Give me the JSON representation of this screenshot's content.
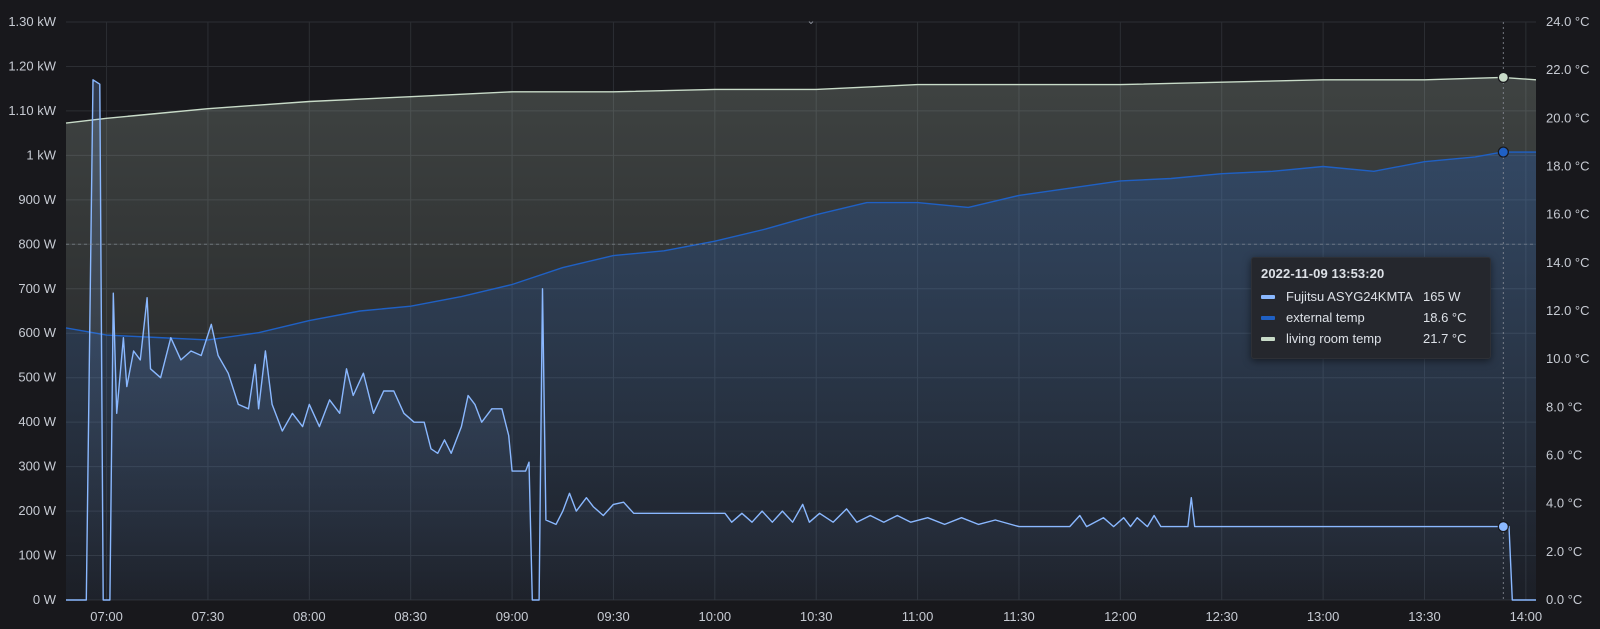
{
  "chart_data": {
    "type": "area",
    "x_ticks": [
      "07:00",
      "07:30",
      "08:00",
      "08:30",
      "09:00",
      "09:30",
      "10:00",
      "10:30",
      "11:00",
      "11:30",
      "12:00",
      "12:30",
      "13:00",
      "13:30",
      "14:00"
    ],
    "y_left_ticks": [
      "0 W",
      "100 W",
      "200 W",
      "300 W",
      "400 W",
      "500 W",
      "600 W",
      "700 W",
      "800 W",
      "900 W",
      "1 kW",
      "1.10 kW",
      "1.20 kW",
      "1.30 kW"
    ],
    "y_right_ticks": [
      "0.0 °C",
      "2.0 °C",
      "4.0 °C",
      "6.0 °C",
      "8.0 °C",
      "10.0 °C",
      "12.0 °C",
      "14.0 °C",
      "16.0 °C",
      "18.0 °C",
      "20.0 °C",
      "22.0 °C",
      "24.0 °C"
    ],
    "y_left_range": [
      0,
      1300
    ],
    "y_right_range": [
      0,
      24
    ],
    "x_range": [
      "06:48",
      "14:03"
    ],
    "threshold_w": 800,
    "grid": true,
    "series": [
      {
        "name": "Fujitsu ASYG24KMTA",
        "axis": "left",
        "unit": "W",
        "color": "#8ab8ff",
        "points": [
          [
            "06:48",
            0
          ],
          [
            "06:54",
            0
          ],
          [
            "06:55",
            600
          ],
          [
            "06:56",
            1170
          ],
          [
            "06:58",
            1160
          ],
          [
            "06:59",
            0
          ],
          [
            "07:01",
            0
          ],
          [
            "07:02",
            690
          ],
          [
            "07:03",
            420
          ],
          [
            "07:05",
            590
          ],
          [
            "07:06",
            480
          ],
          [
            "07:08",
            560
          ],
          [
            "07:10",
            540
          ],
          [
            "07:12",
            680
          ],
          [
            "07:13",
            520
          ],
          [
            "07:16",
            500
          ],
          [
            "07:19",
            590
          ],
          [
            "07:22",
            540
          ],
          [
            "07:25",
            560
          ],
          [
            "07:28",
            550
          ],
          [
            "07:31",
            620
          ],
          [
            "07:33",
            550
          ],
          [
            "07:36",
            510
          ],
          [
            "07:39",
            440
          ],
          [
            "07:42",
            430
          ],
          [
            "07:44",
            530
          ],
          [
            "07:45",
            430
          ],
          [
            "07:47",
            560
          ],
          [
            "07:49",
            440
          ],
          [
            "07:52",
            380
          ],
          [
            "07:55",
            420
          ],
          [
            "07:58",
            390
          ],
          [
            "08:00",
            440
          ],
          [
            "08:03",
            390
          ],
          [
            "08:06",
            450
          ],
          [
            "08:09",
            420
          ],
          [
            "08:11",
            520
          ],
          [
            "08:13",
            460
          ],
          [
            "08:16",
            510
          ],
          [
            "08:19",
            420
          ],
          [
            "08:22",
            470
          ],
          [
            "08:25",
            470
          ],
          [
            "08:28",
            420
          ],
          [
            "08:31",
            400
          ],
          [
            "08:34",
            400
          ],
          [
            "08:36",
            340
          ],
          [
            "08:38",
            330
          ],
          [
            "08:40",
            360
          ],
          [
            "08:42",
            330
          ],
          [
            "08:45",
            390
          ],
          [
            "08:47",
            460
          ],
          [
            "08:49",
            440
          ],
          [
            "08:51",
            400
          ],
          [
            "08:54",
            430
          ],
          [
            "08:57",
            430
          ],
          [
            "08:59",
            370
          ],
          [
            "09:00",
            290
          ],
          [
            "09:04",
            290
          ],
          [
            "09:05",
            310
          ],
          [
            "09:06",
            0
          ],
          [
            "09:08",
            0
          ],
          [
            "09:09",
            700
          ],
          [
            "09:10",
            180
          ],
          [
            "09:13",
            170
          ],
          [
            "09:15",
            200
          ],
          [
            "09:17",
            240
          ],
          [
            "09:19",
            200
          ],
          [
            "09:22",
            230
          ],
          [
            "09:24",
            210
          ],
          [
            "09:27",
            190
          ],
          [
            "09:30",
            215
          ],
          [
            "09:33",
            220
          ],
          [
            "09:36",
            195
          ],
          [
            "09:40",
            195
          ],
          [
            "09:45",
            195
          ],
          [
            "09:50",
            195
          ],
          [
            "09:55",
            195
          ],
          [
            "10:00",
            195
          ],
          [
            "10:03",
            195
          ],
          [
            "10:05",
            175
          ],
          [
            "10:08",
            195
          ],
          [
            "10:11",
            175
          ],
          [
            "10:14",
            200
          ],
          [
            "10:17",
            175
          ],
          [
            "10:20",
            200
          ],
          [
            "10:23",
            175
          ],
          [
            "10:26",
            215
          ],
          [
            "10:28",
            175
          ],
          [
            "10:31",
            195
          ],
          [
            "10:35",
            175
          ],
          [
            "10:39",
            205
          ],
          [
            "10:42",
            175
          ],
          [
            "10:46",
            190
          ],
          [
            "10:50",
            175
          ],
          [
            "10:54",
            190
          ],
          [
            "10:58",
            175
          ],
          [
            "11:03",
            185
          ],
          [
            "11:08",
            170
          ],
          [
            "11:13",
            185
          ],
          [
            "11:18",
            170
          ],
          [
            "11:23",
            180
          ],
          [
            "11:30",
            165
          ],
          [
            "11:45",
            165
          ],
          [
            "11:48",
            190
          ],
          [
            "11:50",
            165
          ],
          [
            "11:55",
            185
          ],
          [
            "11:58",
            165
          ],
          [
            "12:01",
            185
          ],
          [
            "12:03",
            165
          ],
          [
            "12:05",
            185
          ],
          [
            "12:08",
            165
          ],
          [
            "12:10",
            190
          ],
          [
            "12:12",
            165
          ],
          [
            "12:20",
            165
          ],
          [
            "12:21",
            230
          ],
          [
            "12:22",
            165
          ],
          [
            "12:40",
            165
          ],
          [
            "13:00",
            165
          ],
          [
            "13:20",
            165
          ],
          [
            "13:40",
            165
          ],
          [
            "13:53",
            165
          ],
          [
            "13:55",
            165
          ],
          [
            "13:56",
            0
          ],
          [
            "14:03",
            0
          ]
        ]
      },
      {
        "name": "external temp",
        "axis": "right",
        "unit": "°C",
        "color": "#1f60c4",
        "points": [
          [
            "06:48",
            11.3
          ],
          [
            "07:00",
            11.0
          ],
          [
            "07:15",
            10.9
          ],
          [
            "07:30",
            10.8
          ],
          [
            "07:45",
            11.1
          ],
          [
            "08:00",
            11.6
          ],
          [
            "08:15",
            12.0
          ],
          [
            "08:30",
            12.2
          ],
          [
            "08:45",
            12.6
          ],
          [
            "09:00",
            13.1
          ],
          [
            "09:15",
            13.8
          ],
          [
            "09:30",
            14.3
          ],
          [
            "09:45",
            14.5
          ],
          [
            "10:00",
            14.9
          ],
          [
            "10:15",
            15.4
          ],
          [
            "10:30",
            16.0
          ],
          [
            "10:45",
            16.5
          ],
          [
            "11:00",
            16.5
          ],
          [
            "11:15",
            16.3
          ],
          [
            "11:30",
            16.8
          ],
          [
            "11:45",
            17.1
          ],
          [
            "12:00",
            17.4
          ],
          [
            "12:15",
            17.5
          ],
          [
            "12:30",
            17.7
          ],
          [
            "12:45",
            17.8
          ],
          [
            "13:00",
            18.0
          ],
          [
            "13:15",
            17.8
          ],
          [
            "13:30",
            18.2
          ],
          [
            "13:45",
            18.4
          ],
          [
            "13:53",
            18.6
          ],
          [
            "14:03",
            18.6
          ]
        ]
      },
      {
        "name": "living room temp",
        "axis": "right",
        "unit": "°C",
        "color": "#c8dbc8",
        "points": [
          [
            "06:48",
            19.8
          ],
          [
            "07:00",
            20.0
          ],
          [
            "07:15",
            20.2
          ],
          [
            "07:30",
            20.4
          ],
          [
            "08:00",
            20.7
          ],
          [
            "08:30",
            20.9
          ],
          [
            "09:00",
            21.1
          ],
          [
            "09:30",
            21.1
          ],
          [
            "10:00",
            21.2
          ],
          [
            "10:30",
            21.2
          ],
          [
            "11:00",
            21.4
          ],
          [
            "11:30",
            21.4
          ],
          [
            "12:00",
            21.4
          ],
          [
            "12:30",
            21.5
          ],
          [
            "13:00",
            21.6
          ],
          [
            "13:30",
            21.6
          ],
          [
            "13:53",
            21.7
          ],
          [
            "14:03",
            21.6
          ]
        ]
      }
    ],
    "hover": {
      "time": "13:53:20",
      "tooltip_title": "2022-11-09 13:53:20",
      "rows": [
        {
          "name": "Fujitsu ASYG24KMTA",
          "value": "165 W",
          "color": "#8ab8ff"
        },
        {
          "name": "external temp",
          "value": "18.6 °C",
          "color": "#1f60c4"
        },
        {
          "name": "living room temp",
          "value": "21.7 °C",
          "color": "#c8dbc8"
        }
      ]
    }
  }
}
